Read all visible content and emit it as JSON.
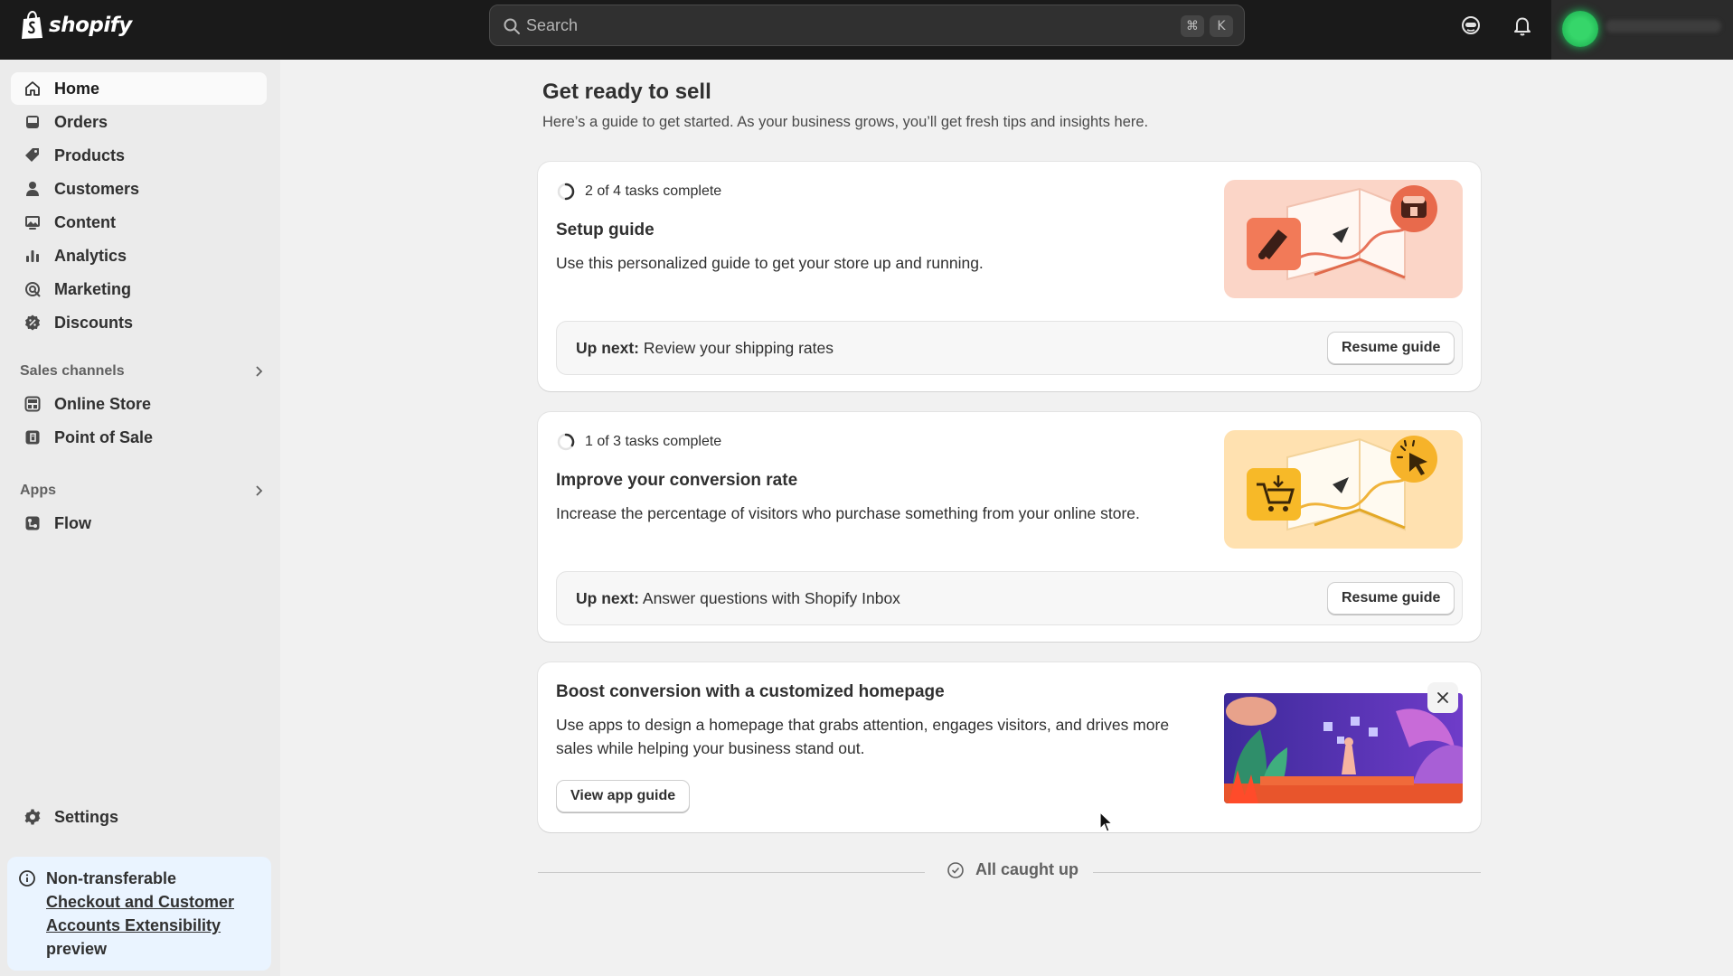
{
  "topbar": {
    "logo_text": "shopify",
    "search_placeholder": "Search",
    "kbd_cmd": "⌘",
    "kbd_k": "K"
  },
  "sidebar": {
    "items": [
      {
        "label": "Home",
        "icon": "home-icon"
      },
      {
        "label": "Orders",
        "icon": "inbox-icon"
      },
      {
        "label": "Products",
        "icon": "tag-icon"
      },
      {
        "label": "Customers",
        "icon": "person-icon"
      },
      {
        "label": "Content",
        "icon": "image-icon"
      },
      {
        "label": "Analytics",
        "icon": "bar-chart-icon"
      },
      {
        "label": "Marketing",
        "icon": "target-icon"
      },
      {
        "label": "Discounts",
        "icon": "discount-icon"
      }
    ],
    "sales_channels_label": "Sales channels",
    "sales_channels": [
      {
        "label": "Online Store",
        "icon": "store-icon"
      },
      {
        "label": "Point of Sale",
        "icon": "pos-icon"
      }
    ],
    "apps_label": "Apps",
    "apps": [
      {
        "label": "Flow",
        "icon": "flow-icon"
      }
    ],
    "settings_label": "Settings",
    "notice": {
      "prefix": "Non-transferable",
      "link": "Checkout and Customer Accounts Extensibility",
      "suffix": "preview"
    }
  },
  "main": {
    "title": "Get ready to sell",
    "subtitle": "Here’s a guide to get started. As your business grows, you’ll get fresh tips and insights here.",
    "cards": [
      {
        "progress_text": "2 of 4 tasks complete",
        "progress_fraction": 0.5,
        "title": "Setup guide",
        "description": "Use this personalized guide to get your store up and running.",
        "upnext_label": "Up next:",
        "upnext_text": "Review your shipping rates",
        "button": "Resume guide"
      },
      {
        "progress_text": "1 of 3 tasks complete",
        "progress_fraction": 0.333,
        "title": "Improve your conversion rate",
        "description": "Increase the percentage of visitors who purchase something from your online store.",
        "upnext_label": "Up next:",
        "upnext_text": "Answer questions with Shopify Inbox",
        "button": "Resume guide"
      },
      {
        "title": "Boost conversion with a customized homepage",
        "description": "Use apps to design a homepage that grabs attention, engages visitors, and drives more sales while helping your business stand out.",
        "button": "View app guide"
      }
    ],
    "caught_up": "All caught up"
  }
}
